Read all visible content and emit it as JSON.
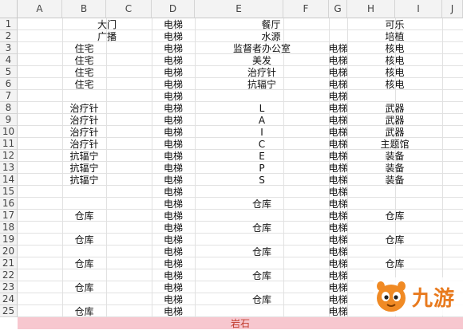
{
  "columns": [
    "A",
    "B",
    "C",
    "D",
    "E",
    "F",
    "G",
    "H",
    "I",
    "J"
  ],
  "rows": [
    "1",
    "2",
    "3",
    "4",
    "5",
    "6",
    "7",
    "8",
    "9",
    "10",
    "11",
    "12",
    "13",
    "14",
    "15",
    "16",
    "17",
    "18",
    "19",
    "20",
    "21",
    "22",
    "23",
    "24",
    "25"
  ],
  "cells": [
    {
      "r": 0,
      "c0": 1,
      "c1": 3,
      "text": "大门"
    },
    {
      "r": 0,
      "c0": 3,
      "c1": 4,
      "text": "电梯"
    },
    {
      "r": 0,
      "c0": 4,
      "c1": 7,
      "text": "餐厅"
    },
    {
      "r": 0,
      "c0": 7,
      "c1": 9,
      "text": "可乐"
    },
    {
      "r": 1,
      "c0": 1,
      "c1": 3,
      "text": "广播"
    },
    {
      "r": 1,
      "c0": 3,
      "c1": 4,
      "text": "电梯"
    },
    {
      "r": 1,
      "c0": 4,
      "c1": 7,
      "text": "水源"
    },
    {
      "r": 1,
      "c0": 7,
      "c1": 9,
      "text": "培植"
    },
    {
      "r": 2,
      "c0": 1,
      "c1": 2,
      "text": "住宅"
    },
    {
      "r": 2,
      "c0": 3,
      "c1": 4,
      "text": "电梯"
    },
    {
      "r": 2,
      "c0": 4,
      "c1": 6,
      "text": "监督者办公室"
    },
    {
      "r": 2,
      "c0": 6,
      "c1": 7,
      "text": "电梯"
    },
    {
      "r": 2,
      "c0": 7,
      "c1": 9,
      "text": "核电"
    },
    {
      "r": 3,
      "c0": 1,
      "c1": 2,
      "text": "住宅"
    },
    {
      "r": 3,
      "c0": 3,
      "c1": 4,
      "text": "电梯"
    },
    {
      "r": 3,
      "c0": 4,
      "c1": 6,
      "text": "美发"
    },
    {
      "r": 3,
      "c0": 6,
      "c1": 7,
      "text": "电梯"
    },
    {
      "r": 3,
      "c0": 7,
      "c1": 9,
      "text": "核电"
    },
    {
      "r": 4,
      "c0": 1,
      "c1": 2,
      "text": "住宅"
    },
    {
      "r": 4,
      "c0": 3,
      "c1": 4,
      "text": "电梯"
    },
    {
      "r": 4,
      "c0": 4,
      "c1": 6,
      "text": "治疗针"
    },
    {
      "r": 4,
      "c0": 6,
      "c1": 7,
      "text": "电梯"
    },
    {
      "r": 4,
      "c0": 7,
      "c1": 9,
      "text": "核电"
    },
    {
      "r": 5,
      "c0": 1,
      "c1": 2,
      "text": "住宅"
    },
    {
      "r": 5,
      "c0": 3,
      "c1": 4,
      "text": "电梯"
    },
    {
      "r": 5,
      "c0": 4,
      "c1": 6,
      "text": "抗辐宁"
    },
    {
      "r": 5,
      "c0": 6,
      "c1": 7,
      "text": "电梯"
    },
    {
      "r": 5,
      "c0": 7,
      "c1": 9,
      "text": "核电"
    },
    {
      "r": 6,
      "c0": 3,
      "c1": 4,
      "text": "电梯"
    },
    {
      "r": 6,
      "c0": 6,
      "c1": 7,
      "text": "电梯"
    },
    {
      "r": 7,
      "c0": 1,
      "c1": 2,
      "text": "治疗针"
    },
    {
      "r": 7,
      "c0": 3,
      "c1": 4,
      "text": "电梯"
    },
    {
      "r": 7,
      "c0": 4,
      "c1": 6,
      "text": "L"
    },
    {
      "r": 7,
      "c0": 6,
      "c1": 7,
      "text": "电梯"
    },
    {
      "r": 7,
      "c0": 7,
      "c1": 9,
      "text": "武器"
    },
    {
      "r": 8,
      "c0": 1,
      "c1": 2,
      "text": "治疗针"
    },
    {
      "r": 8,
      "c0": 3,
      "c1": 4,
      "text": "电梯"
    },
    {
      "r": 8,
      "c0": 4,
      "c1": 6,
      "text": "A"
    },
    {
      "r": 8,
      "c0": 6,
      "c1": 7,
      "text": "电梯"
    },
    {
      "r": 8,
      "c0": 7,
      "c1": 9,
      "text": "武器"
    },
    {
      "r": 9,
      "c0": 1,
      "c1": 2,
      "text": "治疗针"
    },
    {
      "r": 9,
      "c0": 3,
      "c1": 4,
      "text": "电梯"
    },
    {
      "r": 9,
      "c0": 4,
      "c1": 6,
      "text": "I"
    },
    {
      "r": 9,
      "c0": 6,
      "c1": 7,
      "text": "电梯"
    },
    {
      "r": 9,
      "c0": 7,
      "c1": 9,
      "text": "武器"
    },
    {
      "r": 10,
      "c0": 1,
      "c1": 2,
      "text": "治疗针"
    },
    {
      "r": 10,
      "c0": 3,
      "c1": 4,
      "text": "电梯"
    },
    {
      "r": 10,
      "c0": 4,
      "c1": 6,
      "text": "C"
    },
    {
      "r": 10,
      "c0": 6,
      "c1": 7,
      "text": "电梯"
    },
    {
      "r": 10,
      "c0": 7,
      "c1": 9,
      "text": "主题馆"
    },
    {
      "r": 11,
      "c0": 1,
      "c1": 2,
      "text": "抗辐宁"
    },
    {
      "r": 11,
      "c0": 3,
      "c1": 4,
      "text": "电梯"
    },
    {
      "r": 11,
      "c0": 4,
      "c1": 6,
      "text": "E"
    },
    {
      "r": 11,
      "c0": 6,
      "c1": 7,
      "text": "电梯"
    },
    {
      "r": 11,
      "c0": 7,
      "c1": 9,
      "text": "装备"
    },
    {
      "r": 12,
      "c0": 1,
      "c1": 2,
      "text": "抗辐宁"
    },
    {
      "r": 12,
      "c0": 3,
      "c1": 4,
      "text": "电梯"
    },
    {
      "r": 12,
      "c0": 4,
      "c1": 6,
      "text": "P"
    },
    {
      "r": 12,
      "c0": 6,
      "c1": 7,
      "text": "电梯"
    },
    {
      "r": 12,
      "c0": 7,
      "c1": 9,
      "text": "装备"
    },
    {
      "r": 13,
      "c0": 1,
      "c1": 2,
      "text": "抗辐宁"
    },
    {
      "r": 13,
      "c0": 3,
      "c1": 4,
      "text": "电梯"
    },
    {
      "r": 13,
      "c0": 4,
      "c1": 6,
      "text": "S"
    },
    {
      "r": 13,
      "c0": 6,
      "c1": 7,
      "text": "电梯"
    },
    {
      "r": 13,
      "c0": 7,
      "c1": 9,
      "text": "装备"
    },
    {
      "r": 14,
      "c0": 3,
      "c1": 4,
      "text": "电梯"
    },
    {
      "r": 14,
      "c0": 6,
      "c1": 7,
      "text": "电梯"
    },
    {
      "r": 15,
      "c0": 3,
      "c1": 4,
      "text": "电梯"
    },
    {
      "r": 15,
      "c0": 4,
      "c1": 6,
      "text": "仓库"
    },
    {
      "r": 15,
      "c0": 6,
      "c1": 7,
      "text": "电梯"
    },
    {
      "r": 16,
      "c0": 1,
      "c1": 2,
      "text": "仓库"
    },
    {
      "r": 16,
      "c0": 3,
      "c1": 4,
      "text": "电梯"
    },
    {
      "r": 16,
      "c0": 6,
      "c1": 7,
      "text": "电梯"
    },
    {
      "r": 16,
      "c0": 7,
      "c1": 9,
      "text": "仓库"
    },
    {
      "r": 17,
      "c0": 3,
      "c1": 4,
      "text": "电梯"
    },
    {
      "r": 17,
      "c0": 4,
      "c1": 6,
      "text": "仓库"
    },
    {
      "r": 17,
      "c0": 6,
      "c1": 7,
      "text": "电梯"
    },
    {
      "r": 18,
      "c0": 1,
      "c1": 2,
      "text": "仓库"
    },
    {
      "r": 18,
      "c0": 3,
      "c1": 4,
      "text": "电梯"
    },
    {
      "r": 18,
      "c0": 6,
      "c1": 7,
      "text": "电梯"
    },
    {
      "r": 18,
      "c0": 7,
      "c1": 9,
      "text": "仓库"
    },
    {
      "r": 19,
      "c0": 3,
      "c1": 4,
      "text": "电梯"
    },
    {
      "r": 19,
      "c0": 4,
      "c1": 6,
      "text": "仓库"
    },
    {
      "r": 19,
      "c0": 6,
      "c1": 7,
      "text": "电梯"
    },
    {
      "r": 20,
      "c0": 1,
      "c1": 2,
      "text": "仓库"
    },
    {
      "r": 20,
      "c0": 3,
      "c1": 4,
      "text": "电梯"
    },
    {
      "r": 20,
      "c0": 6,
      "c1": 7,
      "text": "电梯"
    },
    {
      "r": 20,
      "c0": 7,
      "c1": 9,
      "text": "仓库"
    },
    {
      "r": 21,
      "c0": 3,
      "c1": 4,
      "text": "电梯"
    },
    {
      "r": 21,
      "c0": 4,
      "c1": 6,
      "text": "仓库"
    },
    {
      "r": 21,
      "c0": 6,
      "c1": 7,
      "text": "电梯"
    },
    {
      "r": 22,
      "c0": 1,
      "c1": 2,
      "text": "仓库"
    },
    {
      "r": 22,
      "c0": 3,
      "c1": 4,
      "text": "电梯"
    },
    {
      "r": 22,
      "c0": 6,
      "c1": 7,
      "text": "电梯"
    },
    {
      "r": 23,
      "c0": 3,
      "c1": 4,
      "text": "电梯"
    },
    {
      "r": 23,
      "c0": 4,
      "c1": 6,
      "text": "仓库"
    },
    {
      "r": 23,
      "c0": 6,
      "c1": 7,
      "text": "电梯"
    },
    {
      "r": 24,
      "c0": 1,
      "c1": 2,
      "text": "仓库"
    },
    {
      "r": 24,
      "c0": 3,
      "c1": 4,
      "text": "电梯"
    },
    {
      "r": 24,
      "c0": 6,
      "c1": 7,
      "text": "电梯"
    }
  ],
  "rock_band": {
    "text": "岩石",
    "color": "#f7c7cf"
  },
  "watermark": {
    "text": "九游",
    "color": "#e87a1e",
    "icon": "jiuyou-logo-icon"
  }
}
